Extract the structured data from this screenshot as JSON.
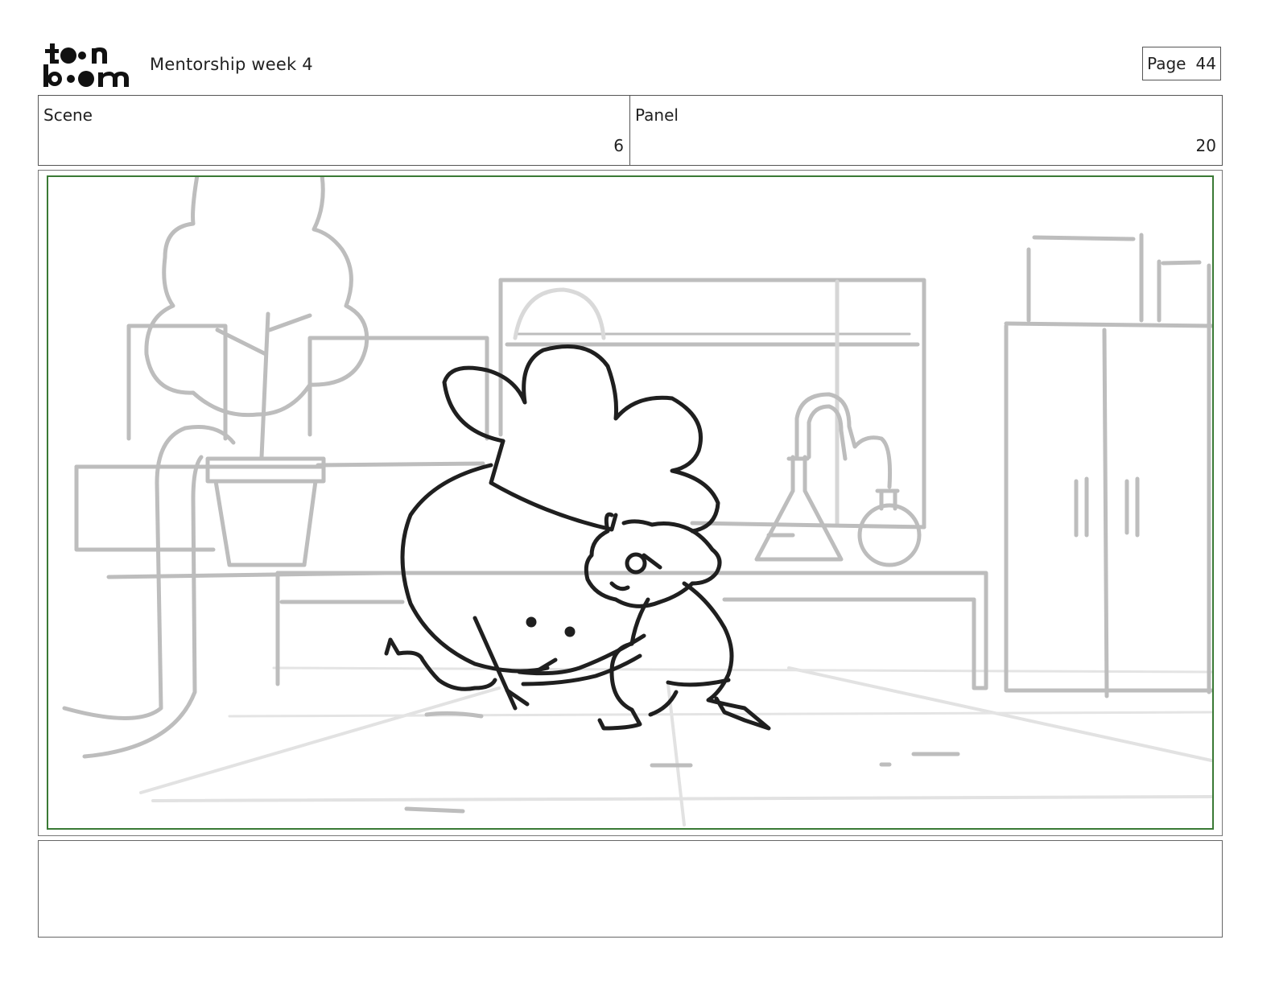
{
  "header": {
    "logo_text": "toonboom",
    "title": "Mentorship week 4",
    "page_label": "Page",
    "page_number": "44"
  },
  "info": {
    "scene_label": "Scene",
    "scene_value": "6",
    "panel_label": "Panel",
    "panel_value": "20"
  },
  "colors": {
    "frame_border": "#3a7a35",
    "sketch_gray": "#b8b8b8",
    "ink": "#1f1f1f"
  },
  "notes": {
    "text": ""
  }
}
